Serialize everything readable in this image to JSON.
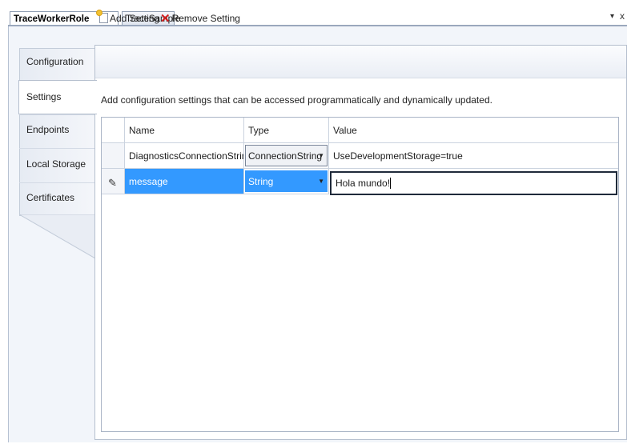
{
  "tabs": {
    "active": "TraceWorkerRole [Role]*",
    "inactive": "TraceSample",
    "menu_glyph": "▾",
    "close_glyph": "x"
  },
  "nav": {
    "items": [
      {
        "label": "Configuration"
      },
      {
        "label": "Settings"
      },
      {
        "label": "Endpoints"
      },
      {
        "label": "Local Storage"
      },
      {
        "label": "Certificates"
      }
    ],
    "selected": "Settings"
  },
  "toolbar": {
    "add_label": "Add Setting",
    "remove_label": "Remove Setting",
    "add_icon": "new-item-icon",
    "remove_icon": "red-x-icon"
  },
  "description": "Add configuration settings that can be accessed programmatically and dynamically updated.",
  "grid": {
    "columns": [
      "Name",
      "Type",
      "Value"
    ],
    "rows": [
      {
        "name": "DiagnosticsConnectionString",
        "type": "ConnectionString",
        "value": "UseDevelopmentStorage=true"
      },
      {
        "name": "message",
        "type": "String",
        "value": "Hola mundo!"
      }
    ],
    "editing_row": 1,
    "edit_glyph": "✎",
    "dropdown_glyph": "▼"
  },
  "colors": {
    "selection": "#3399ff",
    "remove_icon": "#d21d1d",
    "border": "#b5bfce"
  }
}
